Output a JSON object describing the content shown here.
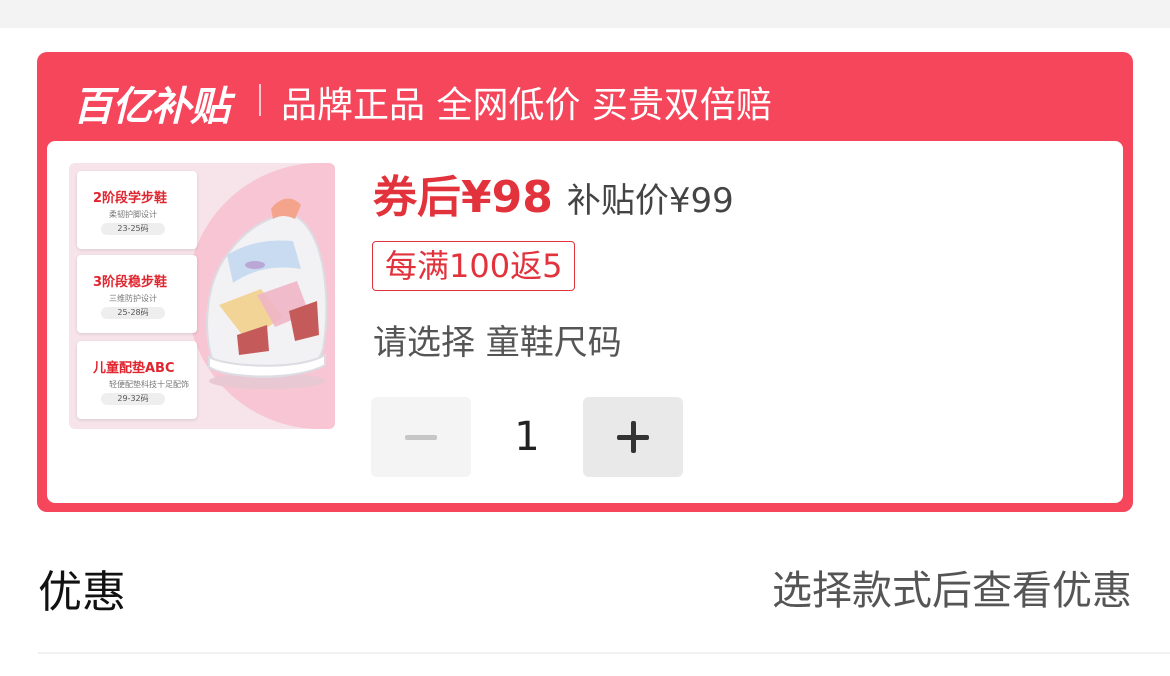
{
  "banner": {
    "brand": "百亿补贴",
    "slogan": "品牌正品 全网低价 买贵双倍赔"
  },
  "product": {
    "thumbnail_specs": [
      {
        "title": "2阶段学步鞋",
        "desc": "柔韧护脚设计",
        "size": "23-25码"
      },
      {
        "title": "3阶段稳步鞋",
        "desc": "三维防护设计",
        "size": "25-28码"
      },
      {
        "title": "儿童配垫ABC",
        "desc": "轻便配垫科技十足配饰",
        "size": "29-32码"
      }
    ],
    "final_price": "券后¥98",
    "subsidy_price": "补贴价¥99",
    "coupon_tag": "每满100返5",
    "select_prompt": "请选择 童鞋尺码"
  },
  "quantity": {
    "value": "1",
    "minus_icon": "minus-icon",
    "plus_icon": "plus-icon"
  },
  "discount": {
    "label": "优惠",
    "hint": "选择款式后查看优惠"
  },
  "colors": {
    "accent": "#f5465c",
    "price_red": "#e2333d"
  }
}
